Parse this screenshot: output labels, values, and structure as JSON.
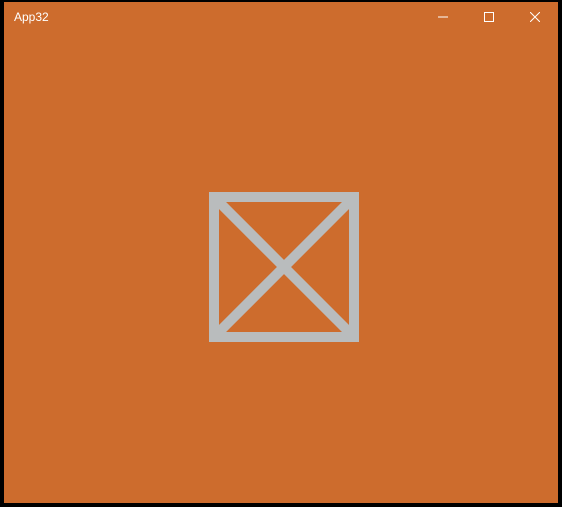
{
  "window": {
    "title": "App32"
  },
  "colors": {
    "background": "#cd6c2d",
    "placeholder_stroke": "#b9bcbd"
  }
}
